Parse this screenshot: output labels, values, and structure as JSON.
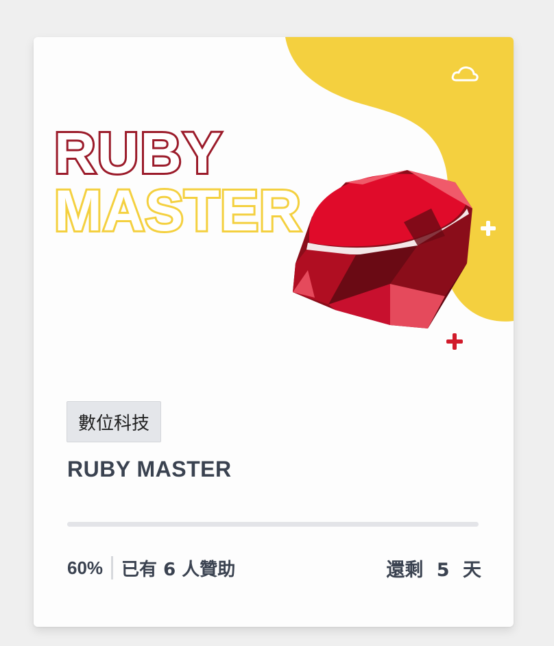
{
  "hero": {
    "logo_line1": "RUBY",
    "logo_line2": "MASTER",
    "icons": [
      "cloud-icon",
      "plus-icon",
      "plus-icon",
      "ruby-gem-icon"
    ]
  },
  "card": {
    "category": "數位科技",
    "title": "RUBY MASTER",
    "progress_percent": 60,
    "progress_label": "60%",
    "backers_text": "已有 6 人贊助",
    "days_left_text": "還剩 5 天"
  },
  "colors": {
    "accent_yellow": "#f4d03f",
    "ruby_red": "#c8102e",
    "ruby_dark": "#8a0d1a",
    "text_dark": "#3a4250",
    "tag_bg": "#e4e6ea",
    "track": "#e3e4e8"
  }
}
